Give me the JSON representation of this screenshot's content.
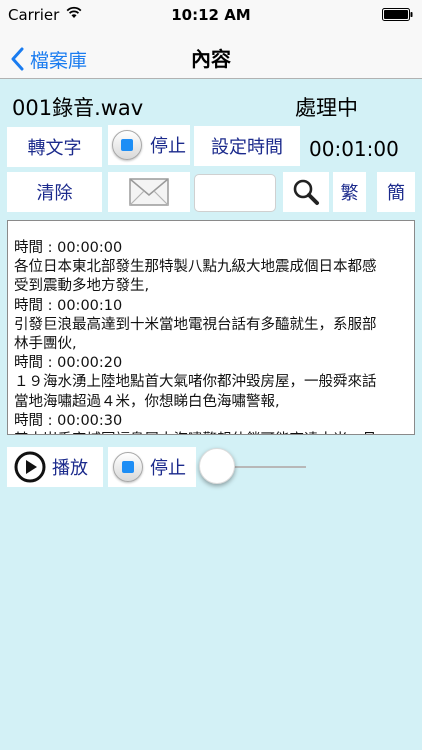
{
  "statusbar": {
    "carrier": "Carrier",
    "time": "10:12 AM"
  },
  "navbar": {
    "back_label": "檔案庫",
    "title": "內容"
  },
  "file": {
    "name": "001錄音.wav",
    "status": "處理中"
  },
  "controls": {
    "transcribe_label": "轉文字",
    "stop_label": "停止",
    "set_time_label": "設定時間",
    "timer": "00:01:00",
    "clear_label": "清除",
    "traditional_label": "繁",
    "simplified_label": "簡"
  },
  "search": {
    "value": ""
  },
  "transcript": {
    "lines": [
      "時間 : 00:00:00",
      "各位日本東北部發生那特製八點九級大地震成個日本都感",
      "受到震動多地方發生,",
      "時間 : 00:00:10",
      "引發巨浪最高達到十米當地電視台話有多醯就生，系服部",
      "林手團伙,",
      "時間 : 00:00:20",
      "１９海水湧上陸地點首大氣啫你都沖毀房屋，一般舜來話",
      "當地海嘯超過４米，你想睇白色海嘯警報,",
      "時間 : 00:00:30",
      "其中岩手宮城同福島屬大海嘯警報什鎖可能高達十米，月"
    ]
  },
  "player": {
    "play_label": "播放",
    "stop_label": "停止",
    "progress": 0.0
  },
  "colors": {
    "background": "#d3f1f6",
    "button_text": "#1b2a8c",
    "accent": "#1a7cf0"
  }
}
